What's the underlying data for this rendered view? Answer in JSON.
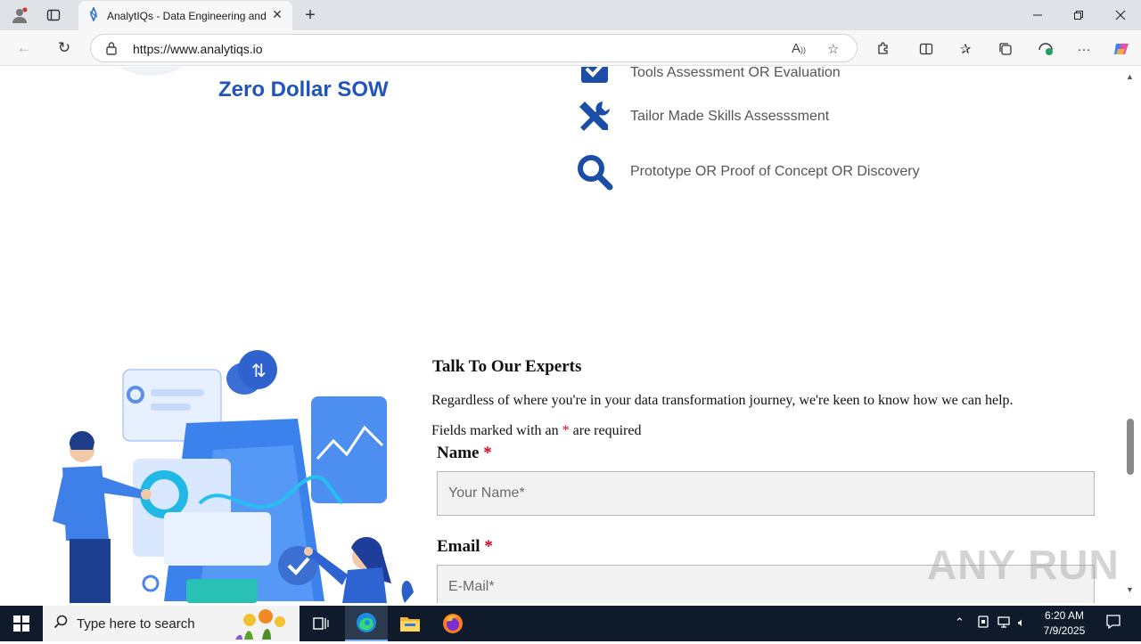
{
  "browser": {
    "tab_title": "AnalytIQs - Data Engineering and",
    "url": "https://www.analytiqs.io"
  },
  "page": {
    "zero_dollar_sow": "Zero Dollar SOW",
    "features": [
      {
        "label": "Tools Assessment OR Evaluation",
        "icon": "checkbox-icon"
      },
      {
        "label": "Tailor Made Skills Assesssment",
        "icon": "tools-icon"
      },
      {
        "label": "Prototype OR Proof of Concept OR Discovery",
        "icon": "search-icon"
      }
    ],
    "experts_heading": "Talk To Our Experts",
    "experts_text": "Regardless of where you're in your data transformation journey, we're keen to know how we can help.",
    "required_prefix": "Fields marked with an",
    "required_star": "*",
    "required_suffix": "are required",
    "form": {
      "name_label": "Name",
      "name_star": "*",
      "name_placeholder": "Your Name*",
      "email_label": "Email",
      "email_star": "*",
      "email_placeholder": "E-Mail*"
    },
    "watermark": "ANY RUN"
  },
  "taskbar": {
    "search_placeholder": "Type here to search",
    "time": "6:20 AM",
    "date": "7/9/2025"
  },
  "colors": {
    "brand_blue": "#2155b9",
    "required_red": "#d0021b"
  }
}
